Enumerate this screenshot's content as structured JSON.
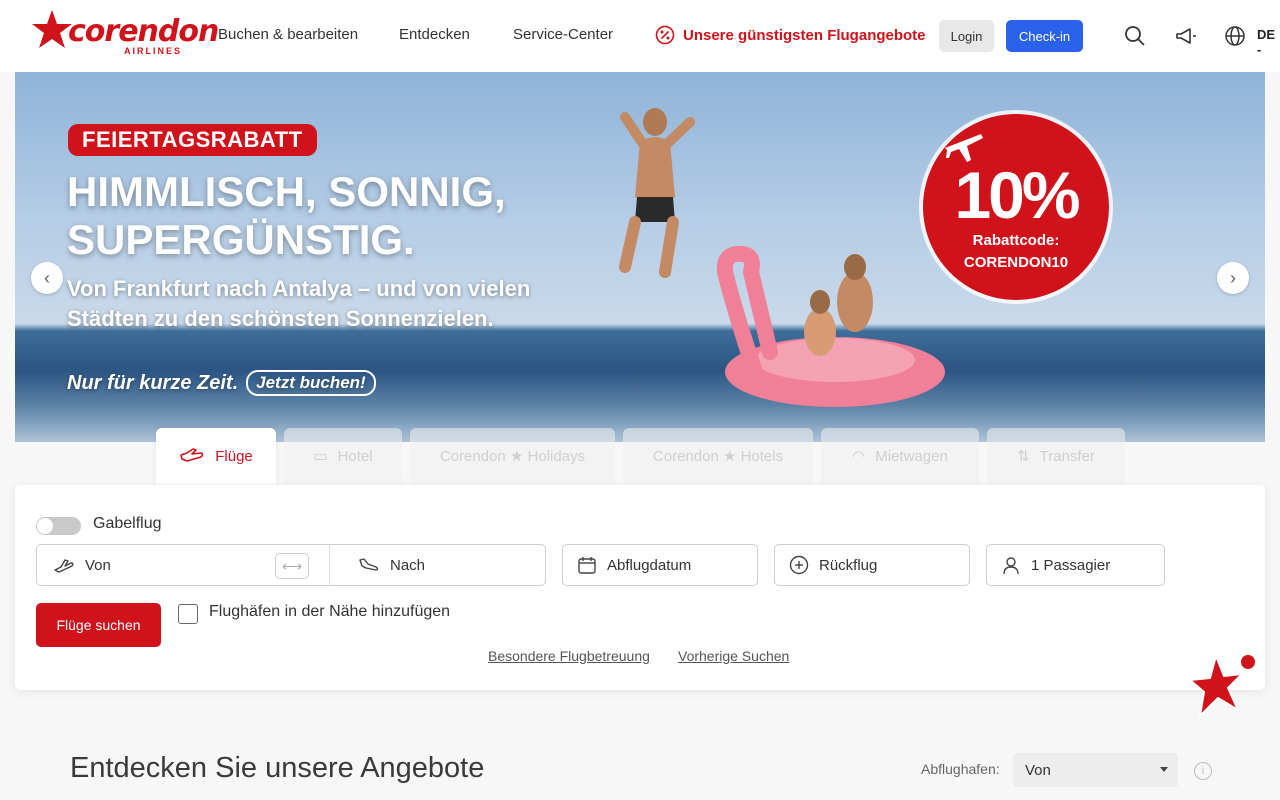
{
  "brand": {
    "name": "corendon",
    "sub": "AIRLINES"
  },
  "nav": {
    "items": [
      "Buchen & bearbeiten",
      "Entdecken",
      "Service-Center"
    ],
    "promo": "Unsere günstigsten Flugangebote"
  },
  "header": {
    "login": "Login",
    "checkin": "Check-in",
    "language": "DE -"
  },
  "hero": {
    "badge": "FEIERTAGSRABATT",
    "headline_1": "HIMMLISCH, SONNIG,",
    "headline_2": "SUPERGÜNSTIG.",
    "sub_1": "Von Frankfurt nach Antalya – und von vielen",
    "sub_2": "Städten zu den schönsten Sonnenzielen.",
    "short_time": "Nur für kurze Zeit.",
    "book_now": "Jetzt buchen!",
    "discount": "10%",
    "code_label": "Rabattcode:",
    "code": "CORENDON10"
  },
  "tabs": [
    {
      "label": "Flüge",
      "active": true
    },
    {
      "label": "Hotel",
      "active": false
    },
    {
      "label": "Corendon ★ Holidays",
      "active": false
    },
    {
      "label": "Corendon ★ Hotels",
      "active": false
    },
    {
      "label": "Mietwagen",
      "active": false
    },
    {
      "label": "Transfer",
      "active": false
    }
  ],
  "search": {
    "openjaw_label": "Gabelflug",
    "from": "Von",
    "to": "Nach",
    "departure": "Abflugdatum",
    "return": "Rückflug",
    "passengers": "1 Passagier",
    "submit": "Flüge suchen",
    "nearby": "Flughäfen in der Nähe hinzufügen",
    "link_assist": "Besondere Flugbetreuung",
    "link_previous": "Vorherige Suchen"
  },
  "offers": {
    "title": "Entdecken Sie unsere Angebote",
    "departure_label": "Abflughafen:",
    "departure_value": "Von"
  },
  "colors": {
    "brand_red": "#d0121b",
    "checkin_blue": "#2962e8"
  }
}
